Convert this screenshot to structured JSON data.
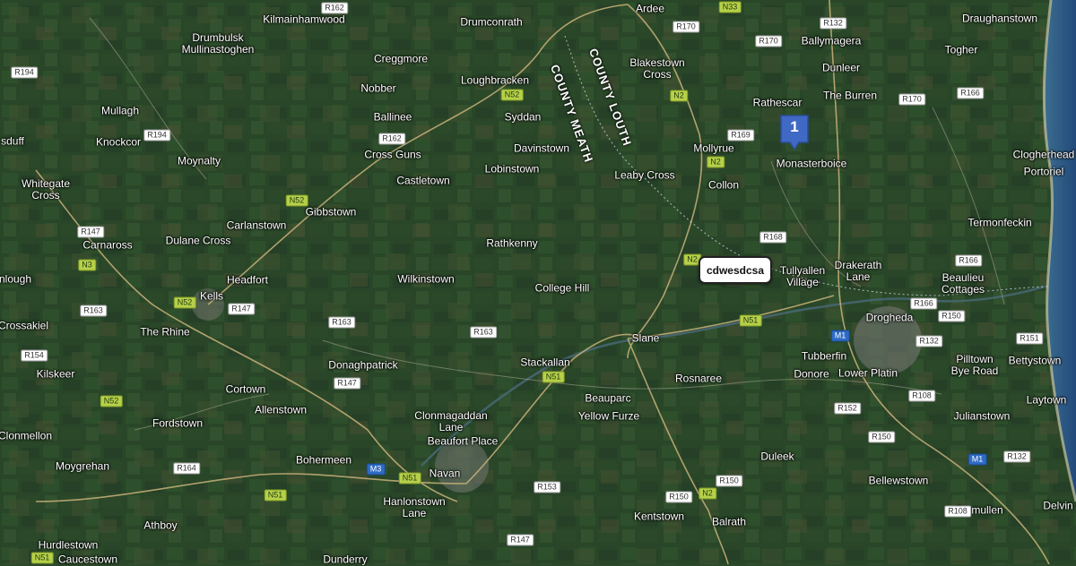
{
  "map": {
    "places": [
      "Kilmainhamwood",
      "Drumconrath",
      "Ardee",
      "Draughanstown",
      "Ballymagera",
      "Drumbulsk Mullinastoghen",
      "Creggmore",
      "Blakestown Cross",
      "Dunleer",
      "Togher",
      "Loughbracken",
      "Nobber",
      "Rathescar",
      "The Burren",
      "Mullagh",
      "Syddan",
      "Ballinee",
      "Knockcor",
      "Davinstown",
      "Mollyrue",
      "Monasterboice",
      "Clogherhead",
      "Moynalty",
      "Cross Guns",
      "Lobinstown",
      "Leaby Cross",
      "Portoriel",
      "Whitegate Cross",
      "Castletown",
      "Collon",
      "Gibbstown",
      "Carlanstown",
      "Termonfeckin",
      "Carnaross",
      "Dulane Cross",
      "Rathkenny",
      "Tullyallen Village",
      "Drakerath Lane",
      "Beaulieu Cottages",
      "nlough",
      "Headfort",
      "Wilkinstown",
      "College Hill",
      "Kells",
      "Drogheda",
      "Crossakiel",
      "The Rhine",
      "Slane",
      "Tubberfin",
      "Pilltown Bye Road",
      "Bettystown",
      "Donaghpatrick",
      "Stackallan",
      "Donore",
      "Lower Platin",
      "Kilskeer",
      "Cortown",
      "Rosnaree",
      "Laytown",
      "Beauparc",
      "Allenstown",
      "Clonmagaddan Lane",
      "Yellow Furze",
      "Julianstown",
      "Fordstown",
      "Beaufort Place",
      "Clonmellon",
      "Bohermeen",
      "Duleek",
      "Moygrehan",
      "Navan",
      "Bellewstown",
      "Hanlonstown Lane",
      "Kentstown",
      "Delvin",
      "Athboy",
      "Balrath",
      "Stamullen",
      "Hurdlestown",
      "Caucestown",
      "Dunderry",
      "sduff"
    ],
    "roads": [
      "R162",
      "R132",
      "N33",
      "R170",
      "R170",
      "R194",
      "N52",
      "N2",
      "R170",
      "R166",
      "R194",
      "R162",
      "R169",
      "N2",
      "N52",
      "R147",
      "R168",
      "N3",
      "N2",
      "R166",
      "N52",
      "R147",
      "R163",
      "R163",
      "R166",
      "R150",
      "N51",
      "M1",
      "R132",
      "R151",
      "R154",
      "R163",
      "R147",
      "N51",
      "N52",
      "R108",
      "R152",
      "R150",
      "M3",
      "N51",
      "R164",
      "M1",
      "R132",
      "N51",
      "R153",
      "R150",
      "N2",
      "R150",
      "R108",
      "N51",
      "R147"
    ],
    "counties": [
      "COUNTY MEATH",
      "COUNTY LOUTH"
    ]
  },
  "marker": {
    "number": "1"
  },
  "callout": {
    "label": "cdwesdcsa"
  },
  "colors": {
    "land": "#2e4d2b",
    "sea": "#2a5585",
    "marker": "#3f69c4"
  }
}
